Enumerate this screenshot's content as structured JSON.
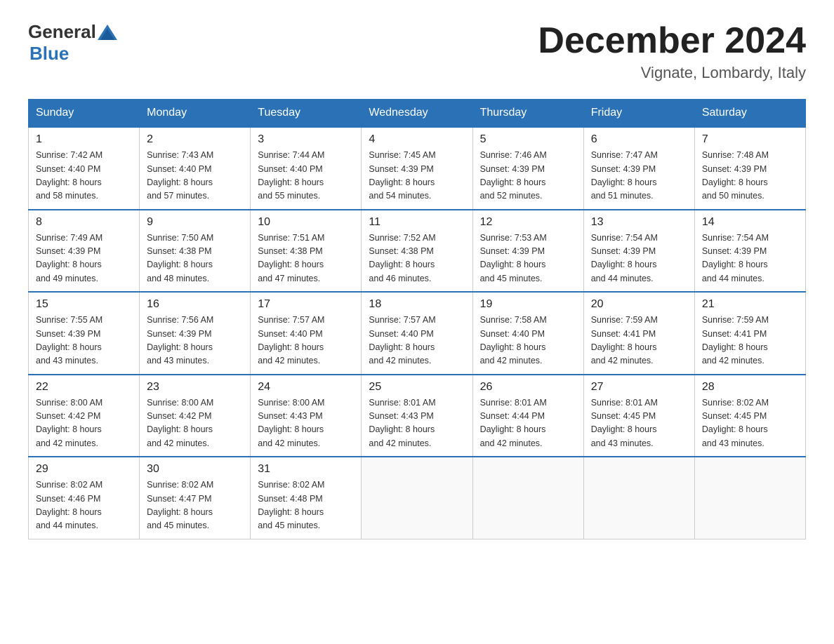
{
  "header": {
    "logo_general": "General",
    "logo_blue": "Blue",
    "title": "December 2024",
    "subtitle": "Vignate, Lombardy, Italy"
  },
  "days_of_week": [
    "Sunday",
    "Monday",
    "Tuesday",
    "Wednesday",
    "Thursday",
    "Friday",
    "Saturday"
  ],
  "weeks": [
    [
      {
        "day": "1",
        "sunrise": "Sunrise: 7:42 AM",
        "sunset": "Sunset: 4:40 PM",
        "daylight": "Daylight: 8 hours",
        "daylight2": "and 58 minutes."
      },
      {
        "day": "2",
        "sunrise": "Sunrise: 7:43 AM",
        "sunset": "Sunset: 4:40 PM",
        "daylight": "Daylight: 8 hours",
        "daylight2": "and 57 minutes."
      },
      {
        "day": "3",
        "sunrise": "Sunrise: 7:44 AM",
        "sunset": "Sunset: 4:40 PM",
        "daylight": "Daylight: 8 hours",
        "daylight2": "and 55 minutes."
      },
      {
        "day": "4",
        "sunrise": "Sunrise: 7:45 AM",
        "sunset": "Sunset: 4:39 PM",
        "daylight": "Daylight: 8 hours",
        "daylight2": "and 54 minutes."
      },
      {
        "day": "5",
        "sunrise": "Sunrise: 7:46 AM",
        "sunset": "Sunset: 4:39 PM",
        "daylight": "Daylight: 8 hours",
        "daylight2": "and 52 minutes."
      },
      {
        "day": "6",
        "sunrise": "Sunrise: 7:47 AM",
        "sunset": "Sunset: 4:39 PM",
        "daylight": "Daylight: 8 hours",
        "daylight2": "and 51 minutes."
      },
      {
        "day": "7",
        "sunrise": "Sunrise: 7:48 AM",
        "sunset": "Sunset: 4:39 PM",
        "daylight": "Daylight: 8 hours",
        "daylight2": "and 50 minutes."
      }
    ],
    [
      {
        "day": "8",
        "sunrise": "Sunrise: 7:49 AM",
        "sunset": "Sunset: 4:39 PM",
        "daylight": "Daylight: 8 hours",
        "daylight2": "and 49 minutes."
      },
      {
        "day": "9",
        "sunrise": "Sunrise: 7:50 AM",
        "sunset": "Sunset: 4:38 PM",
        "daylight": "Daylight: 8 hours",
        "daylight2": "and 48 minutes."
      },
      {
        "day": "10",
        "sunrise": "Sunrise: 7:51 AM",
        "sunset": "Sunset: 4:38 PM",
        "daylight": "Daylight: 8 hours",
        "daylight2": "and 47 minutes."
      },
      {
        "day": "11",
        "sunrise": "Sunrise: 7:52 AM",
        "sunset": "Sunset: 4:38 PM",
        "daylight": "Daylight: 8 hours",
        "daylight2": "and 46 minutes."
      },
      {
        "day": "12",
        "sunrise": "Sunrise: 7:53 AM",
        "sunset": "Sunset: 4:39 PM",
        "daylight": "Daylight: 8 hours",
        "daylight2": "and 45 minutes."
      },
      {
        "day": "13",
        "sunrise": "Sunrise: 7:54 AM",
        "sunset": "Sunset: 4:39 PM",
        "daylight": "Daylight: 8 hours",
        "daylight2": "and 44 minutes."
      },
      {
        "day": "14",
        "sunrise": "Sunrise: 7:54 AM",
        "sunset": "Sunset: 4:39 PM",
        "daylight": "Daylight: 8 hours",
        "daylight2": "and 44 minutes."
      }
    ],
    [
      {
        "day": "15",
        "sunrise": "Sunrise: 7:55 AM",
        "sunset": "Sunset: 4:39 PM",
        "daylight": "Daylight: 8 hours",
        "daylight2": "and 43 minutes."
      },
      {
        "day": "16",
        "sunrise": "Sunrise: 7:56 AM",
        "sunset": "Sunset: 4:39 PM",
        "daylight": "Daylight: 8 hours",
        "daylight2": "and 43 minutes."
      },
      {
        "day": "17",
        "sunrise": "Sunrise: 7:57 AM",
        "sunset": "Sunset: 4:40 PM",
        "daylight": "Daylight: 8 hours",
        "daylight2": "and 42 minutes."
      },
      {
        "day": "18",
        "sunrise": "Sunrise: 7:57 AM",
        "sunset": "Sunset: 4:40 PM",
        "daylight": "Daylight: 8 hours",
        "daylight2": "and 42 minutes."
      },
      {
        "day": "19",
        "sunrise": "Sunrise: 7:58 AM",
        "sunset": "Sunset: 4:40 PM",
        "daylight": "Daylight: 8 hours",
        "daylight2": "and 42 minutes."
      },
      {
        "day": "20",
        "sunrise": "Sunrise: 7:59 AM",
        "sunset": "Sunset: 4:41 PM",
        "daylight": "Daylight: 8 hours",
        "daylight2": "and 42 minutes."
      },
      {
        "day": "21",
        "sunrise": "Sunrise: 7:59 AM",
        "sunset": "Sunset: 4:41 PM",
        "daylight": "Daylight: 8 hours",
        "daylight2": "and 42 minutes."
      }
    ],
    [
      {
        "day": "22",
        "sunrise": "Sunrise: 8:00 AM",
        "sunset": "Sunset: 4:42 PM",
        "daylight": "Daylight: 8 hours",
        "daylight2": "and 42 minutes."
      },
      {
        "day": "23",
        "sunrise": "Sunrise: 8:00 AM",
        "sunset": "Sunset: 4:42 PM",
        "daylight": "Daylight: 8 hours",
        "daylight2": "and 42 minutes."
      },
      {
        "day": "24",
        "sunrise": "Sunrise: 8:00 AM",
        "sunset": "Sunset: 4:43 PM",
        "daylight": "Daylight: 8 hours",
        "daylight2": "and 42 minutes."
      },
      {
        "day": "25",
        "sunrise": "Sunrise: 8:01 AM",
        "sunset": "Sunset: 4:43 PM",
        "daylight": "Daylight: 8 hours",
        "daylight2": "and 42 minutes."
      },
      {
        "day": "26",
        "sunrise": "Sunrise: 8:01 AM",
        "sunset": "Sunset: 4:44 PM",
        "daylight": "Daylight: 8 hours",
        "daylight2": "and 42 minutes."
      },
      {
        "day": "27",
        "sunrise": "Sunrise: 8:01 AM",
        "sunset": "Sunset: 4:45 PM",
        "daylight": "Daylight: 8 hours",
        "daylight2": "and 43 minutes."
      },
      {
        "day": "28",
        "sunrise": "Sunrise: 8:02 AM",
        "sunset": "Sunset: 4:45 PM",
        "daylight": "Daylight: 8 hours",
        "daylight2": "and 43 minutes."
      }
    ],
    [
      {
        "day": "29",
        "sunrise": "Sunrise: 8:02 AM",
        "sunset": "Sunset: 4:46 PM",
        "daylight": "Daylight: 8 hours",
        "daylight2": "and 44 minutes."
      },
      {
        "day": "30",
        "sunrise": "Sunrise: 8:02 AM",
        "sunset": "Sunset: 4:47 PM",
        "daylight": "Daylight: 8 hours",
        "daylight2": "and 45 minutes."
      },
      {
        "day": "31",
        "sunrise": "Sunrise: 8:02 AM",
        "sunset": "Sunset: 4:48 PM",
        "daylight": "Daylight: 8 hours",
        "daylight2": "and 45 minutes."
      },
      null,
      null,
      null,
      null
    ]
  ]
}
